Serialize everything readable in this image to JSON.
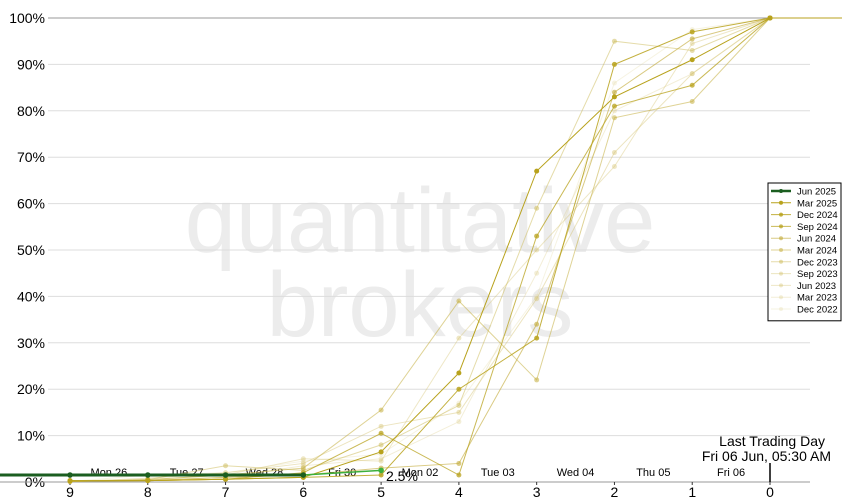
{
  "watermark": {
    "line1": "quantitative",
    "line2": "brokers"
  },
  "chart_data": {
    "type": "line",
    "x": [
      9,
      8,
      7,
      6,
      5,
      4,
      3,
      2,
      1,
      0
    ],
    "xlim": [
      10,
      -0.5
    ],
    "ylim": [
      0,
      100
    ],
    "yticks": [
      "0%",
      "10%",
      "20%",
      "30%",
      "40%",
      "50%",
      "60%",
      "70%",
      "80%",
      "90%",
      "100%"
    ],
    "date_labels": [
      {
        "x": 8.5,
        "label": "Mon 26"
      },
      {
        "x": 7.5,
        "label": "Tue 27"
      },
      {
        "x": 6.5,
        "label": "Wed 28"
      },
      {
        "x": 5.5,
        "label": "Fri 30"
      },
      {
        "x": 4.5,
        "label": "Mon 02"
      },
      {
        "x": 3.5,
        "label": "Tue 03"
      },
      {
        "x": 2.5,
        "label": "Wed 04"
      },
      {
        "x": 1.5,
        "label": "Thu 05"
      },
      {
        "x": 0.5,
        "label": "Fri 06"
      }
    ],
    "current_value_label": "2.5%",
    "annotation": {
      "line1": "Last Trading Day",
      "line2": "Fri 06 Jun, 05:30 AM"
    },
    "legend_position": "right",
    "series": [
      {
        "name": "Jun 2025",
        "color": "#1b5e20",
        "highlight": true,
        "values": [
          1.5,
          1.5,
          1.5,
          1.5,
          2.5,
          null,
          null,
          null,
          null,
          null
        ]
      },
      {
        "name": "Mar 2025",
        "color": "#b8a21c",
        "opacity": 1.0,
        "values": [
          0.3,
          0.3,
          0.6,
          1.0,
          6.5,
          23.5,
          67,
          83,
          91,
          100
        ]
      },
      {
        "name": "Dec 2024",
        "color": "#b8a21c",
        "opacity": 0.85,
        "values": [
          0.3,
          0.3,
          0.6,
          1.0,
          1.5,
          20,
          31,
          90,
          97,
          100
        ]
      },
      {
        "name": "Sep 2024",
        "color": "#b8a21c",
        "opacity": 0.75,
        "values": [
          0.2,
          0.3,
          0.6,
          2.0,
          10.5,
          1.5,
          53,
          81,
          85.5,
          100
        ]
      },
      {
        "name": "Jun 2024",
        "color": "#c4ae40",
        "opacity": 0.65,
        "values": [
          0.2,
          0.3,
          1.0,
          1.5,
          3.0,
          4.0,
          34,
          84,
          95.5,
          100
        ]
      },
      {
        "name": "Mar 2024",
        "color": "#c4ae40",
        "opacity": 0.55,
        "values": [
          0.1,
          0.5,
          1.5,
          3.0,
          15.5,
          39,
          22,
          78.5,
          82,
          100
        ]
      },
      {
        "name": "Dec 2023",
        "color": "#ccba55",
        "opacity": 0.5,
        "values": [
          0.1,
          0.5,
          3.5,
          2.5,
          8.0,
          16.5,
          59,
          95,
          93,
          100
        ]
      },
      {
        "name": "Sep 2023",
        "color": "#d4c470",
        "opacity": 0.45,
        "values": [
          0.1,
          0.8,
          2.0,
          4.0,
          12,
          15,
          39.5,
          71,
          88,
          100
        ]
      },
      {
        "name": "Jun 2023",
        "color": "#d4c470",
        "opacity": 0.4,
        "values": [
          0.1,
          0.5,
          1.5,
          5.0,
          4.5,
          31,
          50,
          68,
          94.5,
          100
        ]
      },
      {
        "name": "Mar 2023",
        "color": "#dccf8c",
        "opacity": 0.35,
        "values": [
          0.1,
          0.4,
          1.0,
          3.5,
          5.0,
          13,
          45,
          80,
          88,
          100
        ]
      },
      {
        "name": "Dec 2022",
        "color": "#e2d7a0",
        "opacity": 0.3,
        "values": [
          0.1,
          1.5,
          2.0,
          4.5,
          6.0,
          17,
          40,
          86,
          97.5,
          100
        ]
      }
    ]
  }
}
